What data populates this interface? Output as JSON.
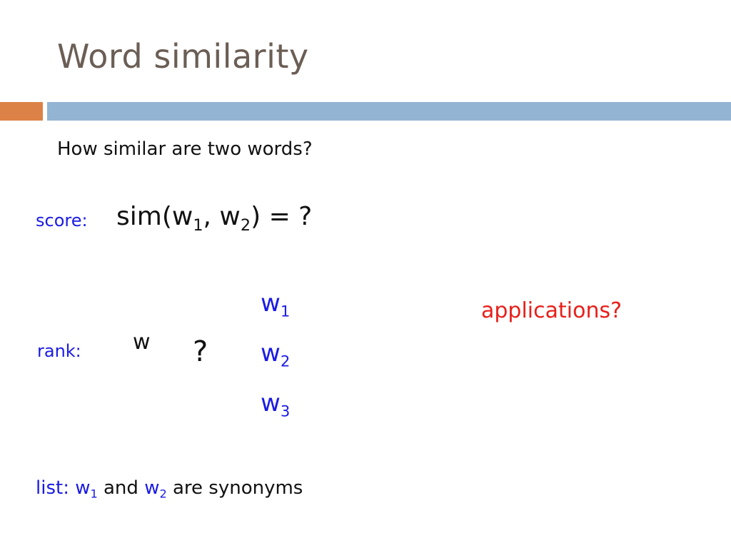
{
  "slide": {
    "title": "Word similarity",
    "subtitle": "How similar are two words?",
    "score": {
      "label": "score:",
      "func": "sim(w",
      "sub1": "1",
      "sep": ", w",
      "sub2": "2",
      "tail": ") = ?"
    },
    "rank": {
      "label": "rank:",
      "target_word": "w",
      "question": "?",
      "candidates": [
        {
          "base": "w",
          "sub": "1"
        },
        {
          "base": "w",
          "sub": "2"
        },
        {
          "base": "w",
          "sub": "3"
        }
      ]
    },
    "applications": "applications?",
    "list": {
      "label": "list:",
      "w1": "w",
      "w1_sub": "1",
      "and": " and ",
      "w2": "w",
      "w2_sub": "2",
      "tail": " are synonyms"
    },
    "colors": {
      "title": "#6b5e55",
      "accent_orange": "#dc8247",
      "accent_blue": "#93b4d3",
      "label_blue": "#1a1ae6",
      "highlight_red": "#e8201a"
    }
  }
}
